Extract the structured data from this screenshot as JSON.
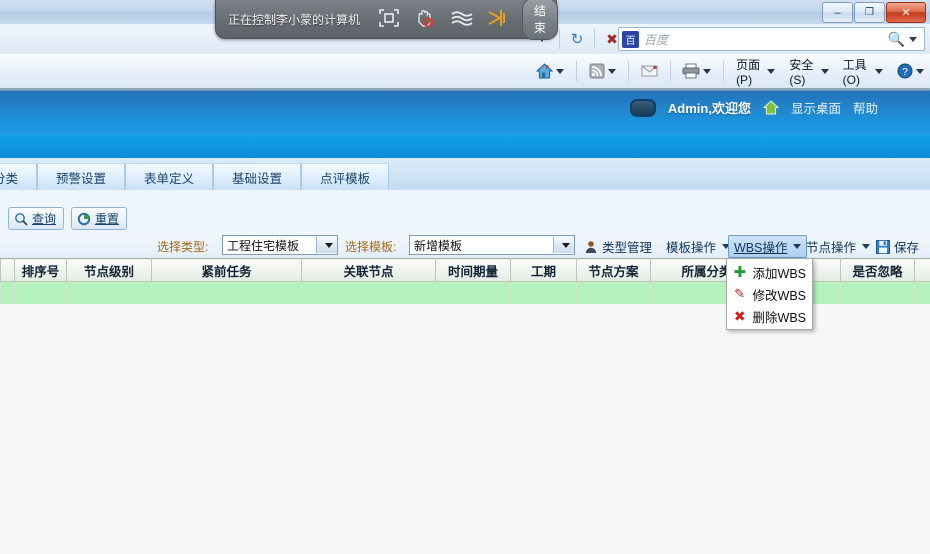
{
  "window": {
    "minimize_label": "–",
    "restore_label": "❐",
    "close_label": "✕"
  },
  "remote_bar": {
    "title": "正在控制李小蒙的计算机",
    "end_button": "结束",
    "icons": [
      "fullscreen-icon",
      "no-control-icon",
      "quality-icon",
      "scissors-icon"
    ]
  },
  "nav_bar": {
    "refresh_icon": "↻",
    "stop_icon": "✕",
    "dropdown_icon": "▾",
    "search": {
      "provider": "百度",
      "logo_glyph": "百",
      "search_icon": "search-icon",
      "value": ""
    }
  },
  "command_bar": {
    "items": [
      {
        "name": "home",
        "label": "",
        "icon": "home-icon",
        "has_caret": true
      },
      {
        "name": "feeds",
        "label": "",
        "icon": "rss-icon",
        "has_caret": true
      },
      {
        "name": "mail",
        "label": "",
        "icon": "mail-icon",
        "has_caret": false
      },
      {
        "name": "print",
        "label": "",
        "icon": "printer-icon",
        "has_caret": true
      },
      {
        "name": "page",
        "label": "页面(P)",
        "icon": "",
        "has_caret": true
      },
      {
        "name": "safety",
        "label": "安全(S)",
        "icon": "",
        "has_caret": true
      },
      {
        "name": "tools",
        "label": "工具(O)",
        "icon": "",
        "has_caret": true
      },
      {
        "name": "help",
        "label": "",
        "icon": "help-icon",
        "has_caret": true
      }
    ]
  },
  "banner": {
    "user_text": "Admin,欢迎您",
    "desktop_link": "显示桌面",
    "help_link": "帮助"
  },
  "tabs": [
    {
      "label": "分类",
      "truncated": true
    },
    {
      "label": "预警设置",
      "truncated": false
    },
    {
      "label": "表单定义",
      "truncated": false
    },
    {
      "label": "基础设置",
      "truncated": false
    },
    {
      "label": "点评模板",
      "truncated": false
    }
  ],
  "query_row": {
    "query_button": "查询",
    "reset_button": "重置"
  },
  "filters": {
    "type_label": "选择类型:",
    "type_value": "工程住宅模板",
    "template_label": "选择模板:",
    "template_value": "新增模板"
  },
  "toolbar": {
    "type_manage": "类型管理",
    "template_ops": "模板操作",
    "wbs_ops": "WBS操作",
    "node_ops": "节点操作",
    "save": "保存"
  },
  "wbs_menu": {
    "items": [
      {
        "label": "添加WBS",
        "icon": "plus-icon",
        "color": "#1f9b2f"
      },
      {
        "label": "修改WBS",
        "icon": "edit-icon",
        "color": "#a52222"
      },
      {
        "label": "删除WBS",
        "icon": "delete-icon",
        "color": "#cc2222"
      }
    ]
  },
  "grid": {
    "columns": [
      "",
      "排序号",
      "节点级别",
      "紧前任务",
      "关联节点",
      "时间期量",
      "工期",
      "节点方案",
      "所属分类",
      "",
      "是否忽略",
      ""
    ],
    "rows": [
      [
        "",
        "",
        "",
        "",
        "",
        "",
        "",
        "",
        "",
        "",
        "",
        ""
      ]
    ]
  },
  "colors": {
    "banner_blue": "#1a8ad4",
    "selected_row_green": "#b6f2bd",
    "filter_label_brown": "#a06a18",
    "toolbar_active": "#aecff0"
  }
}
